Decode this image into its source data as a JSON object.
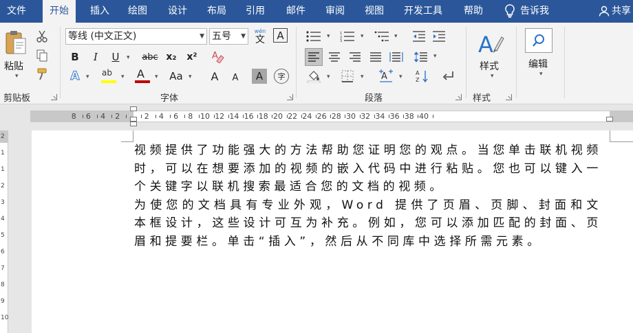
{
  "tabs": [
    {
      "label": "文件",
      "active": false
    },
    {
      "label": "开始",
      "active": true
    },
    {
      "label": "插入",
      "active": false
    },
    {
      "label": "绘图",
      "active": false
    },
    {
      "label": "设计",
      "active": false
    },
    {
      "label": "布局",
      "active": false
    },
    {
      "label": "引用",
      "active": false
    },
    {
      "label": "邮件",
      "active": false
    },
    {
      "label": "审阅",
      "active": false
    },
    {
      "label": "视图",
      "active": false
    },
    {
      "label": "开发工具",
      "active": false
    },
    {
      "label": "帮助",
      "active": false
    }
  ],
  "tell_me": "告诉我",
  "share": "共享",
  "clipboard": {
    "paste_label": "粘贴",
    "group_label": "剪贴板"
  },
  "font": {
    "name": "等线 (中文正文)",
    "size": "五号",
    "phonetic": "wén",
    "phonetic_char": "文",
    "border_char": "A",
    "group_label": "字体",
    "bold": "B",
    "italic": "I",
    "underline": "U",
    "strike": "abc",
    "subscript": "x₂",
    "superscript": "x²",
    "text_effects": "A",
    "highlight": "ab",
    "font_color": "A",
    "change_case": "Aa",
    "grow": "A",
    "shrink": "A",
    "shade": "A",
    "enclose": "字"
  },
  "paragraph": {
    "group_label": "段落"
  },
  "styles": {
    "label": "样式",
    "group_label": "样式"
  },
  "editing": {
    "label": "编辑"
  },
  "ruler_labels": [
    "8",
    "6",
    "4",
    "2",
    "2",
    "4",
    "6",
    "8",
    "10",
    "12",
    "14",
    "16",
    "18",
    "20",
    "22",
    "24",
    "26",
    "28",
    "30",
    "32",
    "34",
    "36",
    "38",
    "40"
  ],
  "vruler_labels": [
    "2",
    "1",
    "1",
    "2",
    "3",
    "4",
    "5",
    "6",
    "7",
    "8",
    "9",
    "10"
  ],
  "document": {
    "paragraphs": [
      "视频提供了功能强大的方法帮助您证明您的观点。当您单击联机视频时，可以在想要添加的视频的嵌入代码中进行粘贴。您也可以键入一个关键字以联机搜索最适合您的文档的视频。",
      "为使您的文档具有专业外观，Word 提供了页眉、页脚、封面和文本框设计，这些设计可互为补充。例如，您可以添加匹配的封面、页眉和提要栏。单击“插入”，然后从不同库中选择所需元素。"
    ]
  },
  "colors": {
    "brand": "#2b579a",
    "font_color_bar": "#c00000",
    "highlight_bar": "#ffff00",
    "accent_icon": "#2b74c7"
  }
}
